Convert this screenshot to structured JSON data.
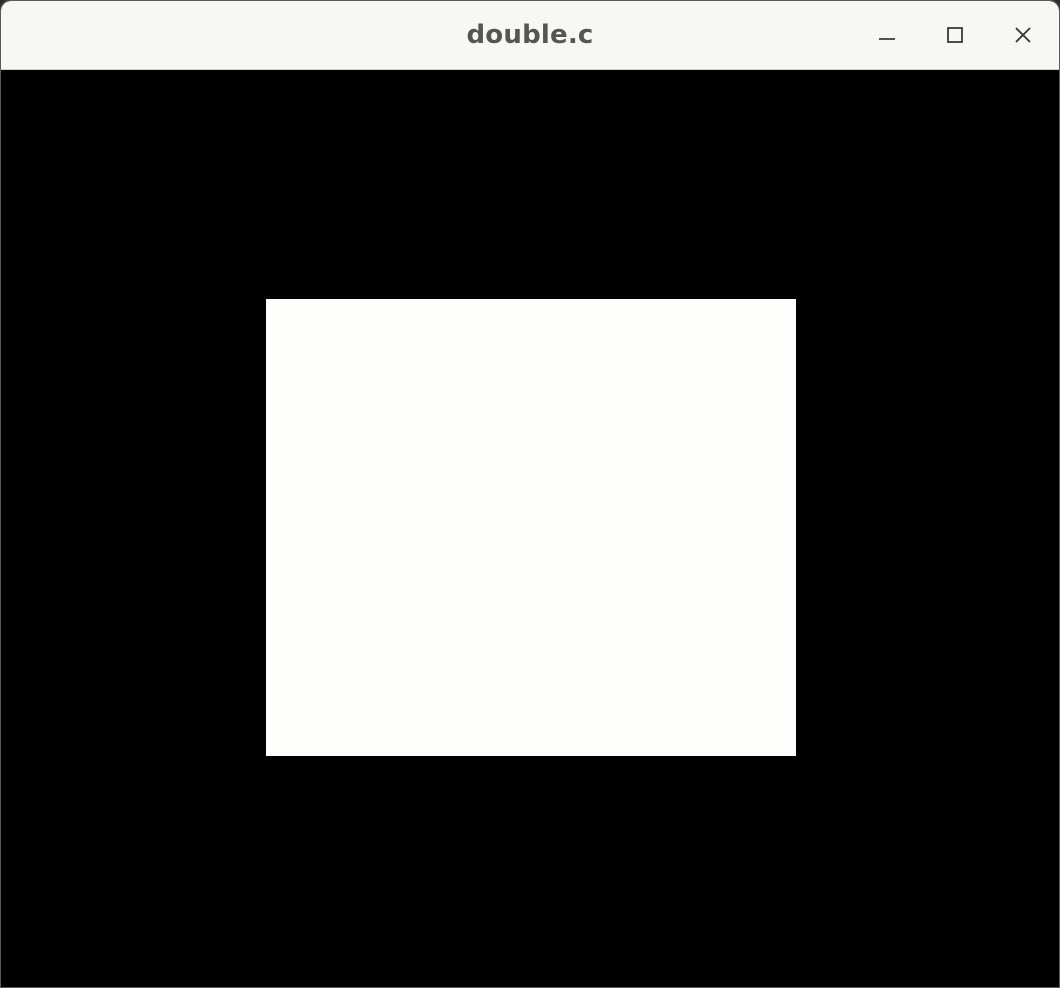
{
  "window": {
    "title": "double.c",
    "controls": {
      "minimize_icon": "minimize-icon",
      "maximize_icon": "maximize-icon",
      "close_icon": "close-icon"
    }
  },
  "canvas": {
    "background_color": "#000000",
    "shape": {
      "kind": "rectangle",
      "fill_color": "#fefefc"
    }
  },
  "colors": {
    "titlebar_bg": "#f7f7f6",
    "title_text": "#555555"
  }
}
